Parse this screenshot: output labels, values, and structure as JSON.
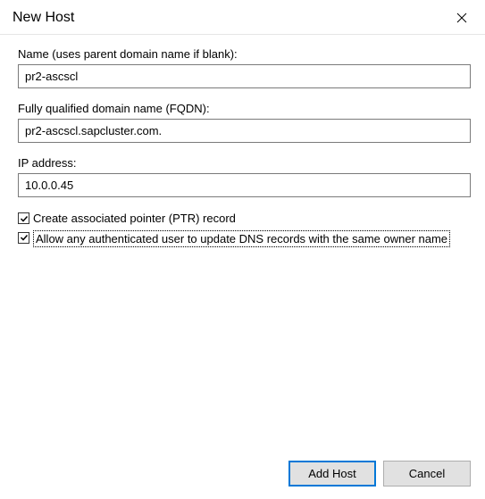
{
  "dialog": {
    "title": "New Host"
  },
  "fields": {
    "name": {
      "label": "Name (uses parent domain name if blank):",
      "value": "pr2-ascscl"
    },
    "fqdn": {
      "label": "Fully qualified domain name (FQDN):",
      "value": "pr2-ascscl.sapcluster.com."
    },
    "ip": {
      "label": "IP address:",
      "value": "10.0.0.45"
    }
  },
  "checkboxes": {
    "ptr": {
      "label": "Create associated pointer (PTR) record",
      "checked": true
    },
    "allow_update": {
      "label": "Allow any authenticated user to update DNS records with the same owner name",
      "checked": true
    }
  },
  "buttons": {
    "add_host": "Add Host",
    "cancel": "Cancel"
  }
}
